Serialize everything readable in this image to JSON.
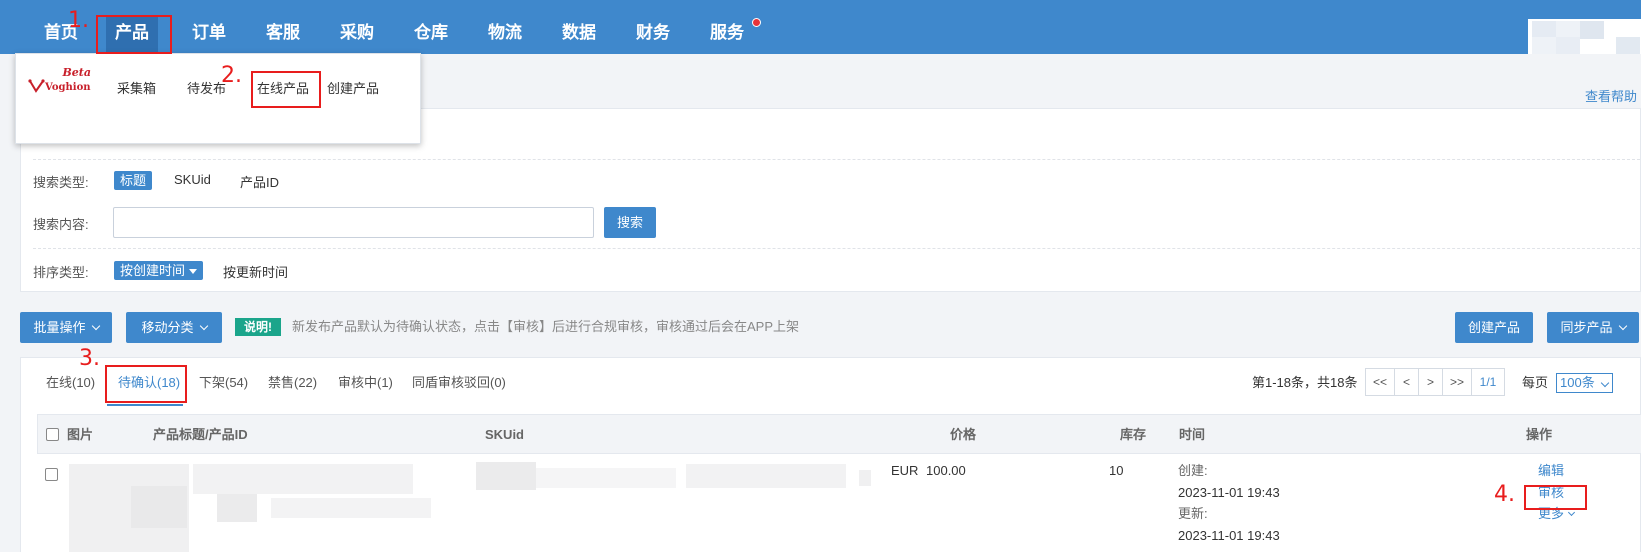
{
  "nav": {
    "items": [
      "首页",
      "产品",
      "订单",
      "客服",
      "采购",
      "仓库",
      "物流",
      "数据",
      "财务",
      "服务"
    ]
  },
  "annotations": [
    "1.",
    "2.",
    "3.",
    "4."
  ],
  "dropdown": {
    "logo_text": "Voghion",
    "logo_badge": "Beta",
    "items": [
      "采集箱",
      "待发布",
      "在线产品",
      "创建产品"
    ]
  },
  "help_link": "查看帮助",
  "filters": {
    "search_type_label": "搜索类型:",
    "search_types": [
      "标题",
      "SKUid",
      "产品ID"
    ],
    "search_content_label": "搜索内容:",
    "search_value": "",
    "search_button": "搜索",
    "sort_type_label": "排序类型:",
    "sort_options": [
      "按创建时间",
      "按更新时间"
    ]
  },
  "toolbar": {
    "batch_button": "批量操作",
    "move_button": "移动分类",
    "notice_tag": "说明!",
    "notice_text": "新发布产品默认为待确认状态，点击【审核】后进行合规审核，审核通过后会在APP上架",
    "create_button": "创建产品",
    "sync_button": "同步产品"
  },
  "tabs": [
    "在线(10)",
    "待确认(18)",
    "下架(54)",
    "禁售(22)",
    "审核中(1)",
    "同盾审核驳回(0)"
  ],
  "pager": {
    "summary": "第1-18条，共18条",
    "buttons": [
      "<<",
      "<",
      ">",
      ">>"
    ],
    "page": "1/1",
    "per_page_label": "每页",
    "per_page_value": "100条"
  },
  "table": {
    "headers": [
      "图片",
      "产品标题/产品ID",
      "SKUid",
      "价格",
      "库存",
      "时间",
      "操作"
    ],
    "rows": [
      {
        "currency": "EUR",
        "price": "100.00",
        "stock": "10",
        "created_label": "创建:",
        "created": "2023-11-01 19:43",
        "updated_label": "更新:",
        "updated": "2023-11-01 19:43",
        "actions": [
          "编辑",
          "审核",
          "更多"
        ]
      }
    ]
  },
  "colors": {
    "nav_bg": "#3f88cc",
    "accent": "#3f88cc",
    "annotation_red": "#e81d1d",
    "notice_green": "#1ba58b"
  }
}
